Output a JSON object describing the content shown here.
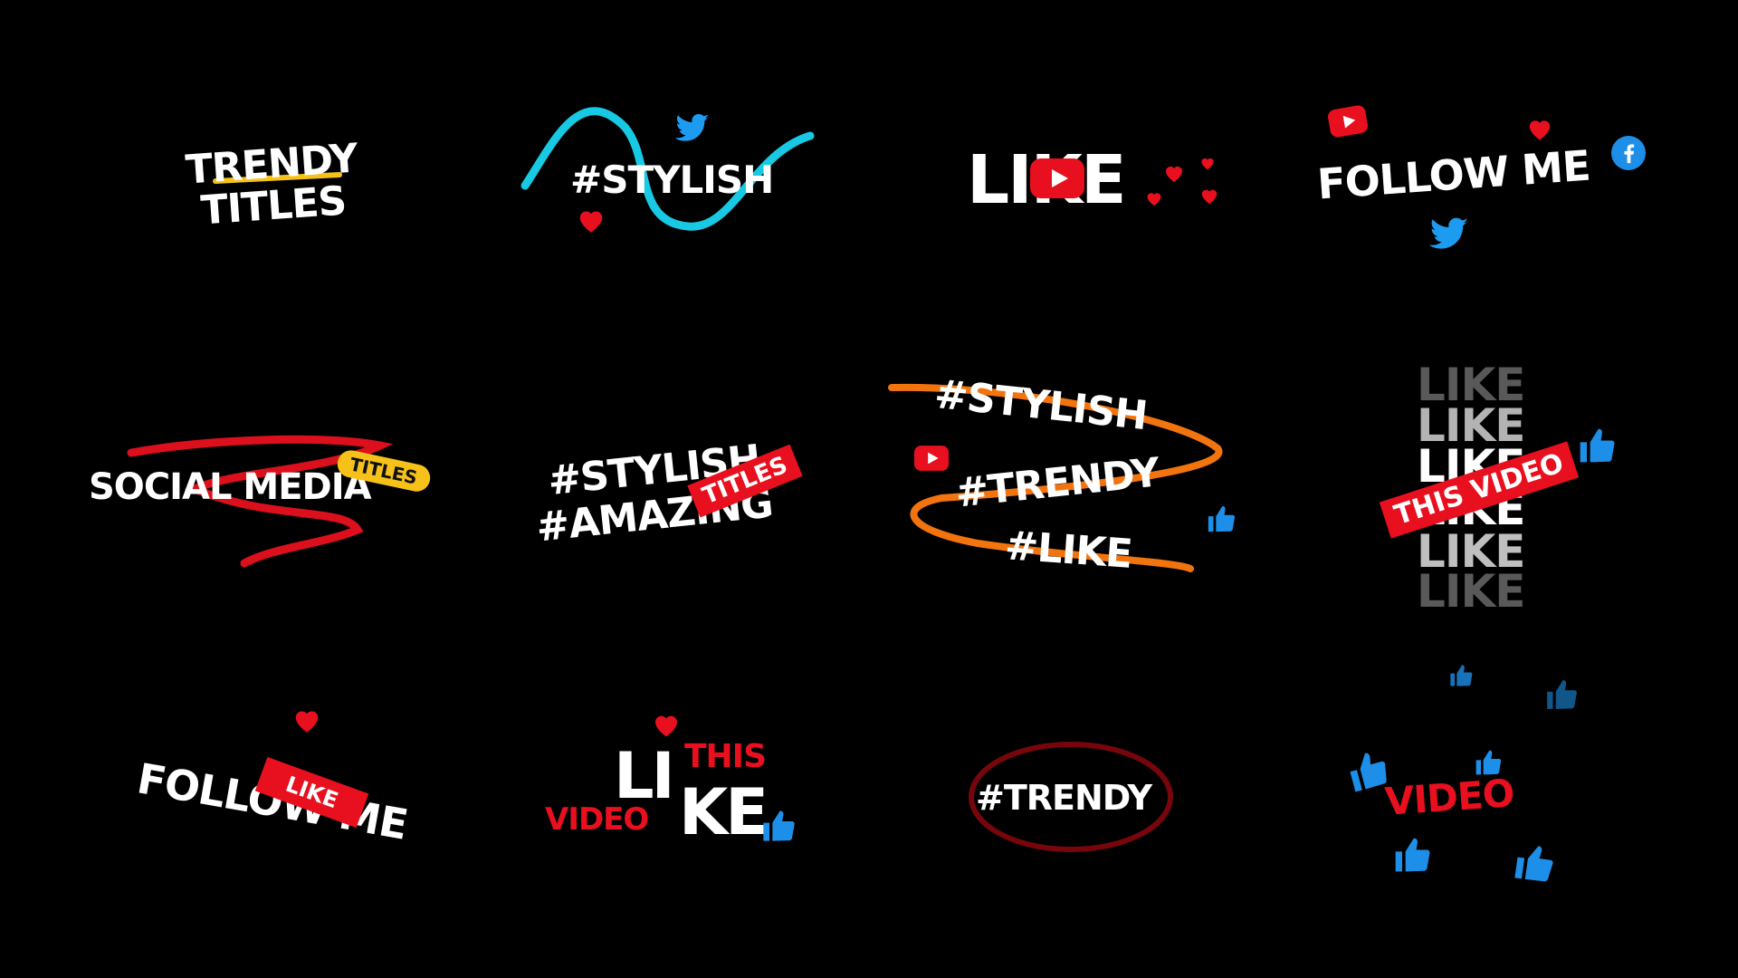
{
  "colors": {
    "background": "#000000",
    "white": "#ffffff",
    "red": "#e8101e",
    "cyan": "#19d4f0",
    "orange": "#ff7a10",
    "yellow": "#f6c21a",
    "blue": "#1d8fe8"
  },
  "icons": [
    "twitter-icon",
    "heart-icon",
    "youtube-icon",
    "facebook-icon",
    "thumbs-up-icon"
  ],
  "tiles": {
    "t1": {
      "line1": "TRENDY",
      "line2": "TITLES"
    },
    "t2": {
      "text": "#STYLISH"
    },
    "t3": {
      "text": "LIKE"
    },
    "t4": {
      "text": "FOLLOW ME"
    },
    "t5": {
      "text": "SOCIAL MEDIA",
      "badge": "TITLES"
    },
    "t6": {
      "line1": "#STYLISH",
      "line2": "#AMAZING",
      "tag": "TITLES"
    },
    "t7": {
      "line1": "#STYLISH",
      "line2": "#TRENDY",
      "line3": "#LIKE"
    },
    "t8": {
      "word": "LIKE",
      "tag": "THIS VIDEO"
    },
    "t9": {
      "text": "FOLLOW ME",
      "tag": "LIKE"
    },
    "t10": {
      "a": "LI",
      "b": "KE",
      "this": "THIS",
      "video": "VIDEO"
    },
    "t11": {
      "text": "#TRENDY"
    },
    "t12": {
      "text": "VIDEO"
    }
  }
}
